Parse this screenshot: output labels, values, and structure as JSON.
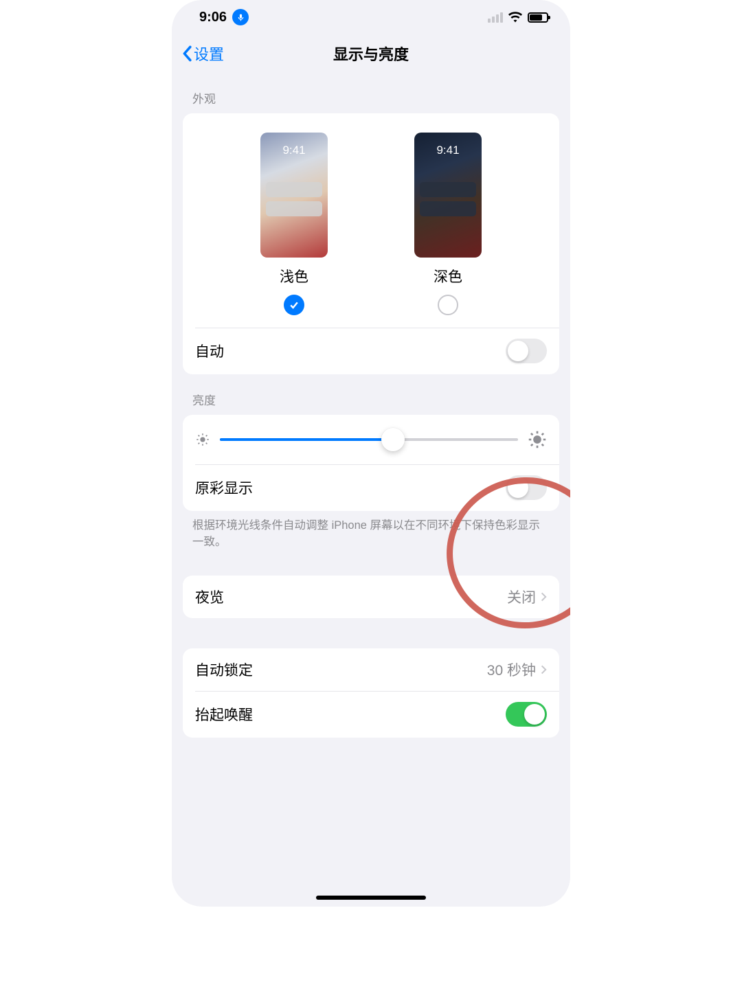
{
  "status": {
    "time": "9:06",
    "battery_pct": 70
  },
  "nav": {
    "back": "设置",
    "title": "显示与亮度"
  },
  "appearance": {
    "header": "外观",
    "light": "浅色",
    "dark": "深色",
    "thumb_time": "9:41",
    "selected": "light",
    "auto_label": "自动",
    "auto_on": false
  },
  "brightness": {
    "header": "亮度",
    "value_pct": 58,
    "true_tone_label": "原彩显示",
    "true_tone_on": false,
    "true_tone_desc": "根据环境光线条件自动调整 iPhone 屏幕以在不同环境下保持色彩显示一致。"
  },
  "night_shift": {
    "label": "夜览",
    "value": "关闭"
  },
  "auto_lock": {
    "label": "自动锁定",
    "value": "30 秒钟"
  },
  "raise_to_wake": {
    "label": "抬起唤醒",
    "on": true
  }
}
